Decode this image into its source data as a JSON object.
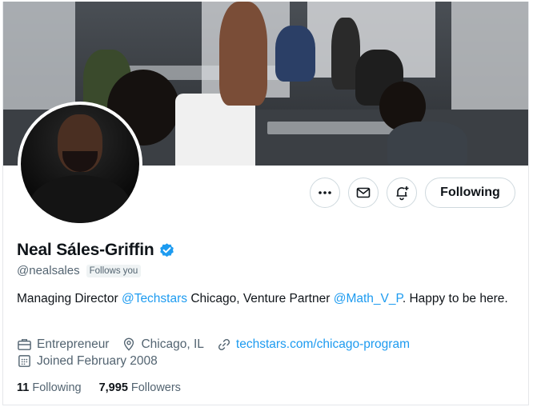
{
  "profile": {
    "name": "Neal Sáles-Griffin",
    "handle": "@nealsales",
    "follows_you": "Follows you",
    "bio_parts": {
      "p1": "Managing Director ",
      "mention1": "@Techstars",
      "p2": " Chicago, Venture Partner ",
      "mention2": "@Math_V_P",
      "p3": ". Happy to be here."
    },
    "category": "Entrepreneur",
    "location": "Chicago, IL",
    "website": "techstars.com/chicago-program",
    "joined": "Joined February 2008"
  },
  "stats": {
    "following_count": "11",
    "following_label": "Following",
    "followers_count": "7,995",
    "followers_label": "Followers"
  },
  "actions": {
    "more_icon": "more-icon",
    "message_icon": "mail-icon",
    "notify_icon": "bell-plus-icon",
    "following_label": "Following"
  },
  "colors": {
    "link": "#1d9bf0",
    "secondary_text": "#536471",
    "verified": "#1d9bf0"
  }
}
